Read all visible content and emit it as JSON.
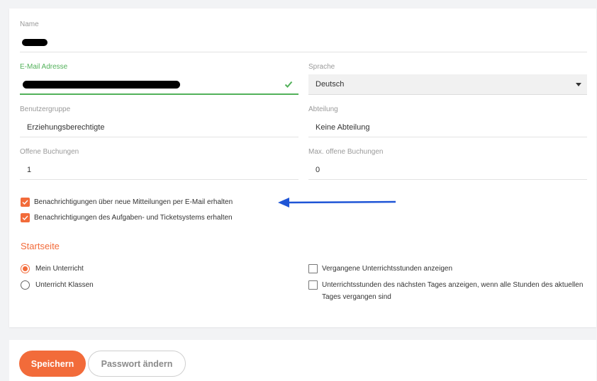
{
  "profile": {
    "name_label": "Name",
    "email_label": "E-Mail Adresse",
    "language_label": "Sprache",
    "language_value": "Deutsch",
    "usergroup_label": "Benutzergruppe",
    "usergroup_value": "Erziehungsberechtigte",
    "department_label": "Abteilung",
    "department_value": "Keine Abteilung",
    "open_bookings_label": "Offene Buchungen",
    "open_bookings_value": "1",
    "max_open_bookings_label": "Max. offene Buchungen",
    "max_open_bookings_value": "0"
  },
  "notifications": {
    "email_messages": {
      "label": "Benachrichtigungen über neue Mitteilungen per E-Mail erhalten",
      "checked": true
    },
    "tasks_tickets": {
      "label": "Benachrichtigungen des Aufgaben- und Ticketsystems erhalten",
      "checked": true
    }
  },
  "startpage": {
    "title": "Startseite",
    "options": [
      {
        "label": "Mein Unterricht",
        "selected": true
      },
      {
        "label": "Unterricht Klassen",
        "selected": false
      }
    ],
    "checkboxes": [
      {
        "label": "Vergangene Unterrichtsstunden anzeigen",
        "checked": false
      },
      {
        "label": "Unterrichtsstunden des nächsten Tages anzeigen, wenn alle Stunden des aktuellen Tages vergangen sind",
        "checked": false
      }
    ]
  },
  "actions": {
    "save_label": "Speichern",
    "change_password_label": "Passwort ändern"
  },
  "colors": {
    "accent": "#f26b3a",
    "valid": "#52b15a",
    "annotation_arrow": "#1f55d6"
  },
  "icons": {
    "email_valid": "check-icon",
    "language_dropdown": "caret-down-icon",
    "annotation": "arrow-left-icon"
  }
}
